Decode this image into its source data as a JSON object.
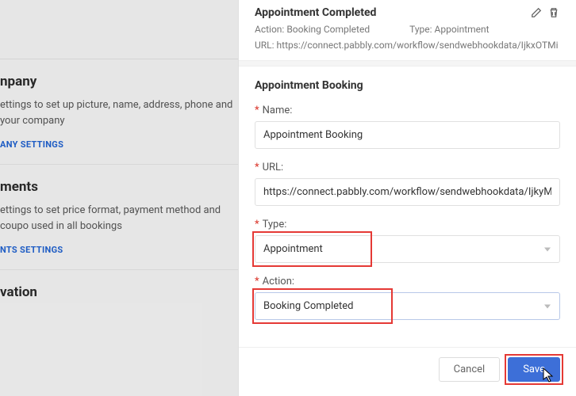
{
  "background": {
    "company": {
      "title": "npany",
      "desc": "ettings to set up picture, name, address, phone and your company",
      "link": "ANY SETTINGS"
    },
    "payments": {
      "title": "ments",
      "desc": "ettings to set price format, payment method and coupo used in all bookings",
      "link": "NTS SETTINGS"
    },
    "activation": {
      "title": "vation"
    }
  },
  "header": {
    "title": "Appointment Completed",
    "action_label": "Action:",
    "action_value": "Booking Completed",
    "type_label": "Type:",
    "type_value": "Appointment",
    "url_label": "URL:",
    "url_value": "https://connect.pabbly.com/workflow/sendwebhookdata/IjkxOTMi"
  },
  "form": {
    "title": "Appointment Booking",
    "name_label": "Name:",
    "name_value": "Appointment Booking",
    "url_label": "URL:",
    "url_value": "https://connect.pabbly.com/workflow/sendwebhookdata/IjkyMDMi",
    "type_label": "Type:",
    "type_value": "Appointment",
    "action_label": "Action:",
    "action_value": "Booking Completed"
  },
  "buttons": {
    "cancel": "Cancel",
    "save": "Save"
  }
}
